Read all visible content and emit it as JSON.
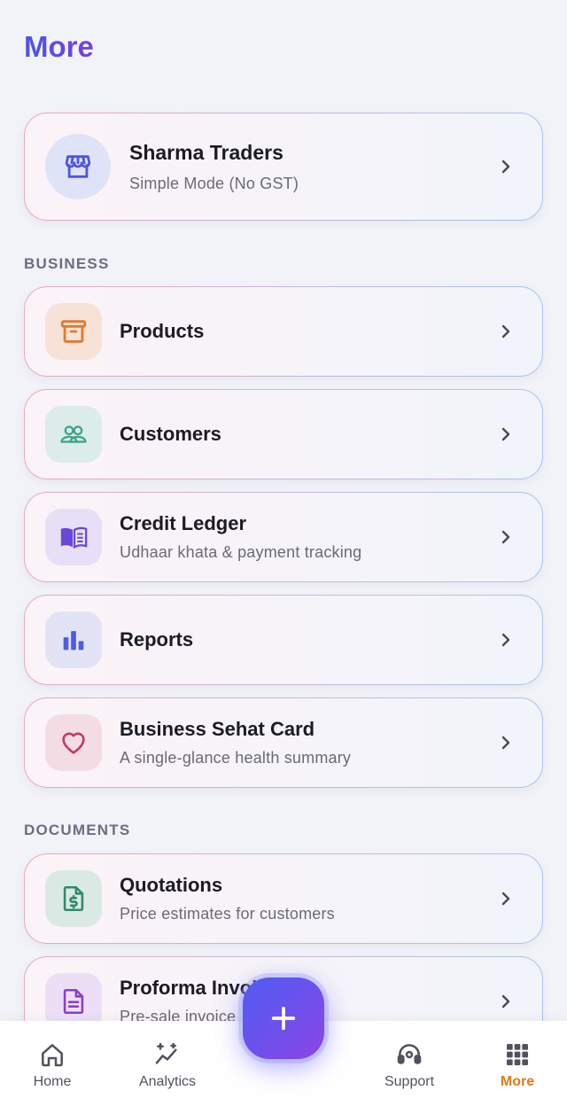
{
  "page": {
    "title": "More"
  },
  "business_card": {
    "name": "Sharma Traders",
    "mode": "Simple Mode (No GST)",
    "icon": "store-icon"
  },
  "sections": {
    "business": {
      "label": "BUSINESS"
    },
    "documents": {
      "label": "DOCUMENTS"
    }
  },
  "menu": {
    "products": {
      "title": "Products",
      "icon": "archive-box-icon",
      "color": "#e07a2e"
    },
    "customers": {
      "title": "Customers",
      "icon": "users-icon",
      "color": "#3aa38a"
    },
    "credit_ledger": {
      "title": "Credit Ledger",
      "subtitle": "Udhaar khata & payment tracking",
      "icon": "book-icon",
      "color": "#6a47d6"
    },
    "reports": {
      "title": "Reports",
      "icon": "bar-chart-icon",
      "color": "#4f5ce0"
    },
    "business_sehat": {
      "title": "Business Sehat Card",
      "subtitle": "A single-glance health summary",
      "icon": "heart-icon",
      "color": "#c23a67"
    },
    "quotations": {
      "title": "Quotations",
      "subtitle": "Price estimates for customers",
      "icon": "dollar-document-icon",
      "color": "#2f8a6c"
    },
    "proforma": {
      "title": "Proforma Invoice",
      "subtitle": "Pre-sale invoice",
      "icon": "document-icon",
      "color": "#8a3fc9"
    }
  },
  "bottom_nav": {
    "home": {
      "label": "Home"
    },
    "analytics": {
      "label": "Analytics"
    },
    "support": {
      "label": "Support"
    },
    "more": {
      "label": "More",
      "active": true
    }
  },
  "fab": {
    "icon": "plus-icon"
  }
}
